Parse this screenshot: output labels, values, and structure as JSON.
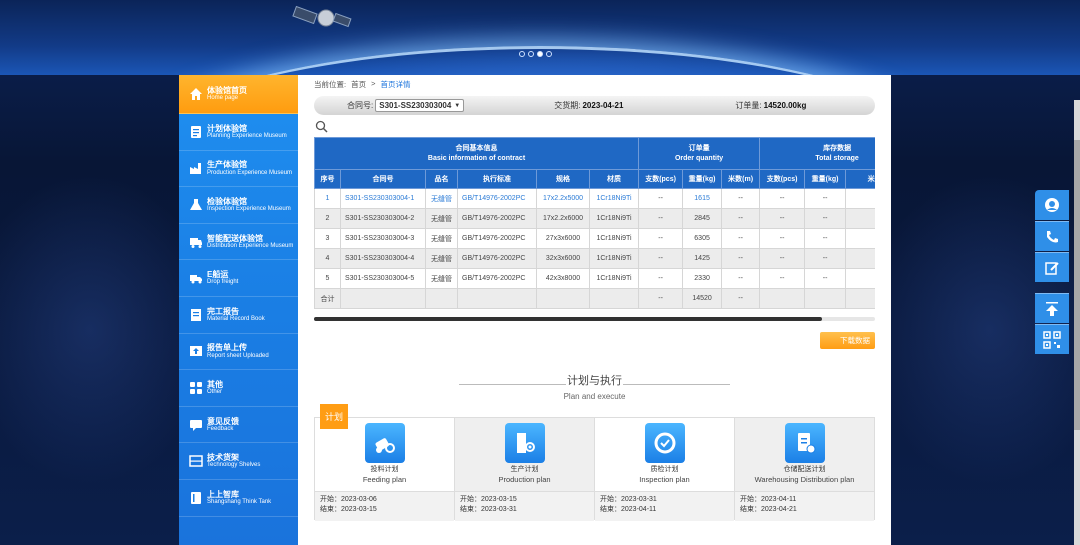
{
  "banner": {
    "carousel_dots": 4,
    "active_dot": 3
  },
  "sidebar": {
    "items": [
      {
        "zh": "体验馆首页",
        "en": "Home page",
        "icon": "home-icon",
        "active": true
      },
      {
        "zh": "计划体验馆",
        "en": "Planning Experience Museum",
        "icon": "document-icon"
      },
      {
        "zh": "生产体验馆",
        "en": "Production Experience Museum",
        "icon": "factory-icon"
      },
      {
        "zh": "检验体验馆",
        "en": "Inspection Experience Museum",
        "icon": "flask-icon"
      },
      {
        "zh": "智能配送体验馆",
        "en": "Distribution Experience Museum",
        "icon": "delivery-icon"
      },
      {
        "zh": "E船运",
        "en": "Drop freight",
        "icon": "truck-icon"
      },
      {
        "zh": "完工报告",
        "en": "Material Record Book",
        "icon": "report-icon"
      },
      {
        "zh": "报告单上传",
        "en": "Report sheet Uploaded",
        "icon": "upload-icon"
      },
      {
        "zh": "其他",
        "en": "Other",
        "icon": "grid-icon"
      },
      {
        "zh": "意见反馈",
        "en": "Feedback",
        "icon": "feedback-icon"
      },
      {
        "zh": "技术货架",
        "en": "Technology Shelves",
        "icon": "shelves-icon"
      },
      {
        "zh": "上上智库",
        "en": "Shangshang Think Tank",
        "icon": "book-icon"
      }
    ]
  },
  "breadcrumb": {
    "label": "当前位置:",
    "home": "首页",
    "sep": ">",
    "current": "首页详情"
  },
  "infobar": {
    "contract_label": "合同号:",
    "contract_value": "S301-SS230303004",
    "delivery_label": "交货期:",
    "delivery_value": "2023-04-21",
    "order_label": "订单量:",
    "order_value": "14520.00kg"
  },
  "table": {
    "group_headers": [
      {
        "zh": "合同基本信息",
        "en": "Basic information of contract"
      },
      {
        "zh": "订单量",
        "en": "Order quantity"
      },
      {
        "zh": "库存数据",
        "en": "Total storage"
      }
    ],
    "columns": [
      "序号",
      "合同号",
      "品名",
      "执行标准",
      "规格",
      "材质",
      "支数(pcs)",
      "重量(kg)",
      "米数(m)",
      "支数(pcs)",
      "重量(kg)",
      "米数(m)"
    ],
    "rows": [
      [
        "1",
        "S301-SS230303004-1",
        "无缝管",
        "GB/T14976-2002PC",
        "17x2.2x5000",
        "1Cr18Ni9Ti",
        "--",
        "1615",
        "--",
        "--",
        "--",
        "--"
      ],
      [
        "2",
        "S301-SS230303004-2",
        "无缝管",
        "GB/T14976-2002PC",
        "17x2.2x6000",
        "1Cr18Ni9Ti",
        "--",
        "2845",
        "--",
        "--",
        "--",
        "--"
      ],
      [
        "3",
        "S301-SS230303004-3",
        "无缝管",
        "GB/T14976-2002PC",
        "27x3x6000",
        "1Cr18Ni9Ti",
        "--",
        "6305",
        "--",
        "--",
        "--",
        "--"
      ],
      [
        "4",
        "S301-SS230303004-4",
        "无缝管",
        "GB/T14976-2002PC",
        "32x3x6000",
        "1Cr18Ni9Ti",
        "--",
        "1425",
        "--",
        "--",
        "--",
        "--"
      ],
      [
        "5",
        "S301-SS230303004-5",
        "无缝管",
        "GB/T14976-2002PC",
        "42x3x8000",
        "1Cr18Ni9Ti",
        "--",
        "2330",
        "--",
        "--",
        "--",
        "--"
      ]
    ],
    "total_row": [
      "合计",
      "",
      "",
      "",
      "",
      "",
      "--",
      "14520",
      "--",
      "",
      "",
      ""
    ]
  },
  "download_label": "下载数据",
  "section": {
    "zh": "计划与执行",
    "en": "Plan and execute"
  },
  "plan_tag": "计划",
  "plans": [
    {
      "zh": "投料计划",
      "en": "Feeding plan",
      "start": "开始：2023-03-06",
      "end": "结束：2023-03-15",
      "icon": "feeding-icon"
    },
    {
      "zh": "生产计划",
      "en": "Production plan",
      "start": "开始：2023-03-15",
      "end": "结束：2023-03-31",
      "icon": "production-icon"
    },
    {
      "zh": "质检计划",
      "en": "Inspection plan",
      "start": "开始：2023-03-31",
      "end": "结束：2023-04-11",
      "icon": "inspection-icon"
    },
    {
      "zh": "仓储配送计划",
      "en": "Warehousing Distribution plan",
      "start": "开始：2023-04-11",
      "end": "结束：2023-04-21",
      "icon": "warehouse-icon"
    }
  ],
  "floating": [
    "customer-service-icon",
    "phone-icon",
    "edit-icon",
    "top-icon",
    "qrcode-icon"
  ],
  "colors": {
    "primary": "#1f68c4",
    "accent": "#ff9d14",
    "sidebar": "#1a7ee4"
  }
}
